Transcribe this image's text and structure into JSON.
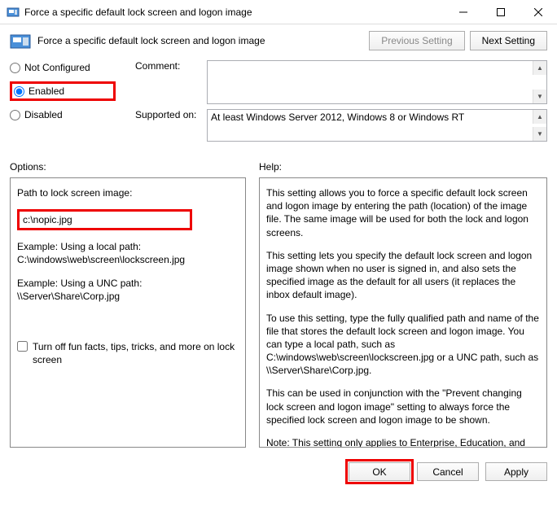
{
  "window": {
    "title": "Force a specific default lock screen and logon image",
    "setting_title": "Force a specific default lock screen and logon image",
    "prev_setting": "Previous Setting",
    "next_setting": "Next Setting"
  },
  "state": {
    "not_configured": "Not Configured",
    "enabled": "Enabled",
    "disabled": "Disabled",
    "selected": "enabled"
  },
  "comment_label": "Comment:",
  "supported_label": "Supported on:",
  "supported_text": "At least Windows Server 2012, Windows 8 or Windows RT",
  "options_label": "Options:",
  "help_label": "Help:",
  "options": {
    "path_label": "Path to lock screen image:",
    "path_value": "c:\\nopic.jpg",
    "example1_label": "Example: Using a local path:",
    "example1_path": "C:\\windows\\web\\screen\\lockscreen.jpg",
    "example2_label": "Example: Using a UNC path:",
    "example2_path": "\\\\Server\\Share\\Corp.jpg",
    "checkbox_label": "Turn off fun facts, tips, tricks, and more on lock screen"
  },
  "help": {
    "p1": "This setting allows you to force a specific default lock screen and logon image by entering the path (location) of the image file. The same image will be used for both the lock and logon screens.",
    "p2": "This setting lets you specify the default lock screen and logon image shown when no user is signed in, and also sets the specified image as the default for all users (it replaces the inbox default image).",
    "p3": "To use this setting, type the fully qualified path and name of the file that stores the default lock screen and logon image. You can type a local path, such as C:\\windows\\web\\screen\\lockscreen.jpg or a UNC path, such as \\\\Server\\Share\\Corp.jpg.",
    "p4": "This can be used in conjunction with the \"Prevent changing lock screen and logon image\" setting to always force the specified lock screen and logon image to be shown.",
    "p5": "Note: This setting only applies to Enterprise, Education, and Server SKUs."
  },
  "footer": {
    "ok": "OK",
    "cancel": "Cancel",
    "apply": "Apply"
  }
}
